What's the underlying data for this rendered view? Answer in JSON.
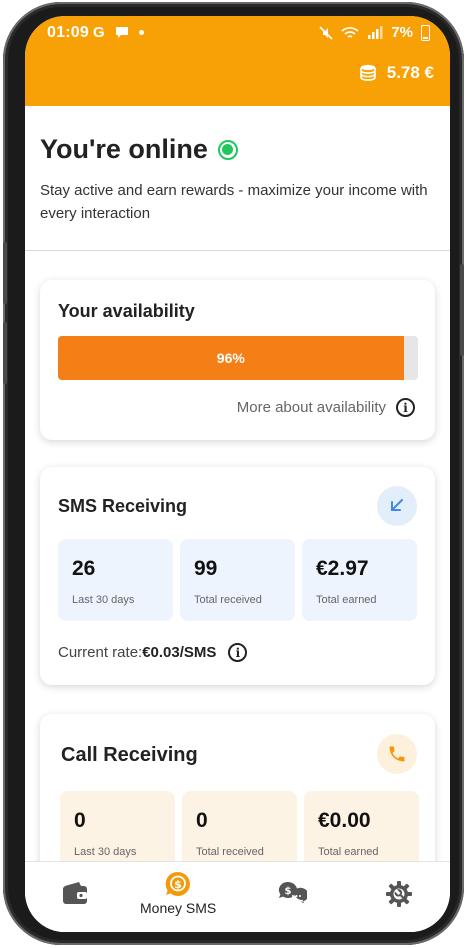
{
  "status_bar": {
    "time": "01:09",
    "carrier_icon": "G",
    "battery": "7%"
  },
  "header": {
    "balance": "5.78 €"
  },
  "online": {
    "title": "You're online",
    "description": "Stay active and earn rewards - maximize your income with every interaction"
  },
  "availability": {
    "title": "Your availability",
    "percent_label": "96%",
    "percent_value": 96,
    "more_link": "More about availability"
  },
  "sms": {
    "title": "SMS Receiving",
    "stats": [
      {
        "value": "26",
        "label": "Last 30 days"
      },
      {
        "value": "99",
        "label": "Total received"
      },
      {
        "value": "€2.97",
        "label": "Total earned"
      }
    ],
    "rate_label": "Current rate:",
    "rate_value": "€0.03/SMS"
  },
  "call": {
    "title": "Call Receiving",
    "stats": [
      {
        "value": "0",
        "label": "Last 30 days"
      },
      {
        "value": "0",
        "label": "Total received"
      },
      {
        "value": "€0.00",
        "label": "Total earned"
      }
    ]
  },
  "nav": {
    "items": [
      {
        "icon": "wallet-icon",
        "label": ""
      },
      {
        "icon": "money-sms-icon",
        "label": "Money SMS"
      },
      {
        "icon": "chat-money-icon",
        "label": ""
      },
      {
        "icon": "settings-icon",
        "label": ""
      }
    ]
  },
  "colors": {
    "accent": "#f8a106",
    "progress": "#f57f17",
    "online": "#22c65e",
    "sms_tile": "#edf4fe",
    "call_tile": "#fdf3e5"
  }
}
